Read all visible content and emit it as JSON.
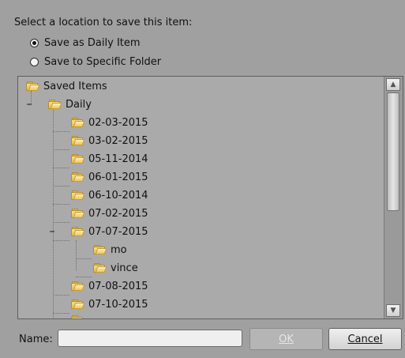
{
  "dialog": {
    "prompt": "Select a location to save this item:",
    "options": [
      {
        "label": "Save as Daily Item",
        "checked": true
      },
      {
        "label": "Save to Specific Folder",
        "checked": false
      }
    ]
  },
  "tree": {
    "nodes": [
      {
        "label": "Saved Items",
        "icon": "folder-icon",
        "level": 0,
        "expander": ""
      },
      {
        "label": "Daily",
        "icon": "folder-icon",
        "level": 1,
        "expander": "–"
      },
      {
        "label": "02-03-2015",
        "icon": "folder-icon",
        "level": 2,
        "expander": ""
      },
      {
        "label": "03-02-2015",
        "icon": "folder-icon",
        "level": 2,
        "expander": ""
      },
      {
        "label": "05-11-2014",
        "icon": "folder-icon",
        "level": 2,
        "expander": ""
      },
      {
        "label": "06-01-2015",
        "icon": "folder-icon",
        "level": 2,
        "expander": ""
      },
      {
        "label": "06-10-2014",
        "icon": "folder-icon",
        "level": 2,
        "expander": ""
      },
      {
        "label": "07-02-2015",
        "icon": "folder-icon",
        "level": 2,
        "expander": ""
      },
      {
        "label": "07-07-2015",
        "icon": "folder-icon",
        "level": 2,
        "expander": "–"
      },
      {
        "label": "mo",
        "icon": "folder-icon",
        "level": 3,
        "expander": ""
      },
      {
        "label": "vince",
        "icon": "folder-icon",
        "level": 3,
        "expander": ""
      },
      {
        "label": "07-08-2015",
        "icon": "folder-icon",
        "level": 2,
        "expander": ""
      },
      {
        "label": "07-10-2015",
        "icon": "folder-icon",
        "level": 2,
        "expander": ""
      }
    ]
  },
  "footer": {
    "name_label": "Name:",
    "name_value": "",
    "ok_label": "OK",
    "cancel_label": "Cancel"
  },
  "colors": {
    "background": "#a0a0a0",
    "tree_background": "#aaaaaa",
    "text": "#111111",
    "folder_yellow": "#e4b84e"
  }
}
